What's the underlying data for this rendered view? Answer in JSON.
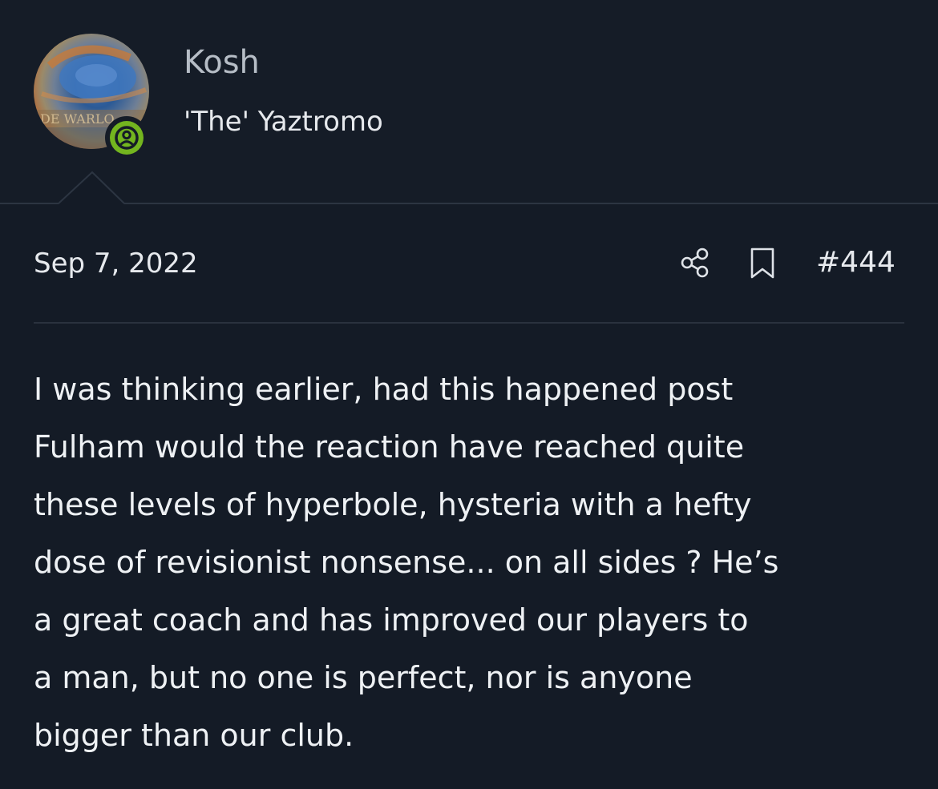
{
  "user": {
    "name": "Kosh",
    "title": "'The' Yaztromo"
  },
  "post": {
    "date": "Sep 7, 2022",
    "number": "#444",
    "body": "I was thinking earlier, had this happened post\nFulham would the reaction have reached quite\nthese levels of hyperbole, hysteria with a hefty\ndose of revisionist nonsense... on all sides ? He’s\na great coach and has improved our players to\na man, but no one is perfect, nor is anyone\nbigger than our club."
  },
  "icons": {
    "share": "share-icon",
    "bookmark": "bookmark-icon",
    "online": "user-online-icon"
  },
  "colors": {
    "background": "#141b26",
    "online_badge": "#73b51f",
    "username": "#b6bdc6",
    "text": "#eef1f4"
  }
}
